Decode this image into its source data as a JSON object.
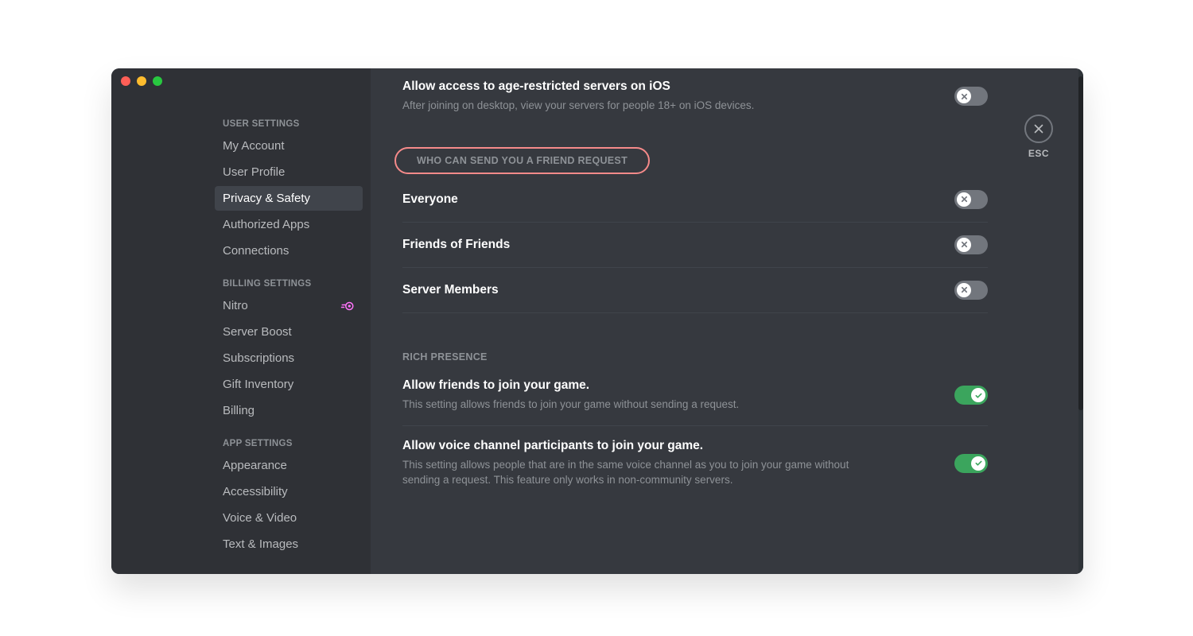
{
  "sidebar": {
    "groups": [
      {
        "label": "USER SETTINGS",
        "items": [
          {
            "label": "My Account",
            "selected": false
          },
          {
            "label": "User Profile",
            "selected": false
          },
          {
            "label": "Privacy & Safety",
            "selected": true
          },
          {
            "label": "Authorized Apps",
            "selected": false
          },
          {
            "label": "Connections",
            "selected": false
          }
        ]
      },
      {
        "label": "BILLING SETTINGS",
        "items": [
          {
            "label": "Nitro",
            "selected": false,
            "badge": "nitro"
          },
          {
            "label": "Server Boost",
            "selected": false
          },
          {
            "label": "Subscriptions",
            "selected": false
          },
          {
            "label": "Gift Inventory",
            "selected": false
          },
          {
            "label": "Billing",
            "selected": false
          }
        ]
      },
      {
        "label": "APP SETTINGS",
        "items": [
          {
            "label": "Appearance",
            "selected": false
          },
          {
            "label": "Accessibility",
            "selected": false
          },
          {
            "label": "Voice & Video",
            "selected": false
          },
          {
            "label": "Text & Images",
            "selected": false
          }
        ]
      }
    ]
  },
  "content": {
    "top_row": {
      "title": "Allow access to age-restricted servers on iOS",
      "desc": "After joining on desktop, view your servers for people 18+ on iOS devices.",
      "on": false
    },
    "friend_header": "WHO CAN SEND YOU A FRIEND REQUEST",
    "friend_rows": [
      {
        "title": "Everyone",
        "on": false
      },
      {
        "title": "Friends of Friends",
        "on": false
      },
      {
        "title": "Server Members",
        "on": false
      }
    ],
    "rich_header": "RICH PRESENCE",
    "rich_rows": [
      {
        "title": "Allow friends to join your game.",
        "desc": "This setting allows friends to join your game without sending a request.",
        "on": true
      },
      {
        "title": "Allow voice channel participants to join your game.",
        "desc": "This setting allows people that are in the same voice channel as you to join your game without sending a request. This feature only works in non-community servers.",
        "on": true
      }
    ]
  },
  "esc_label": "ESC"
}
